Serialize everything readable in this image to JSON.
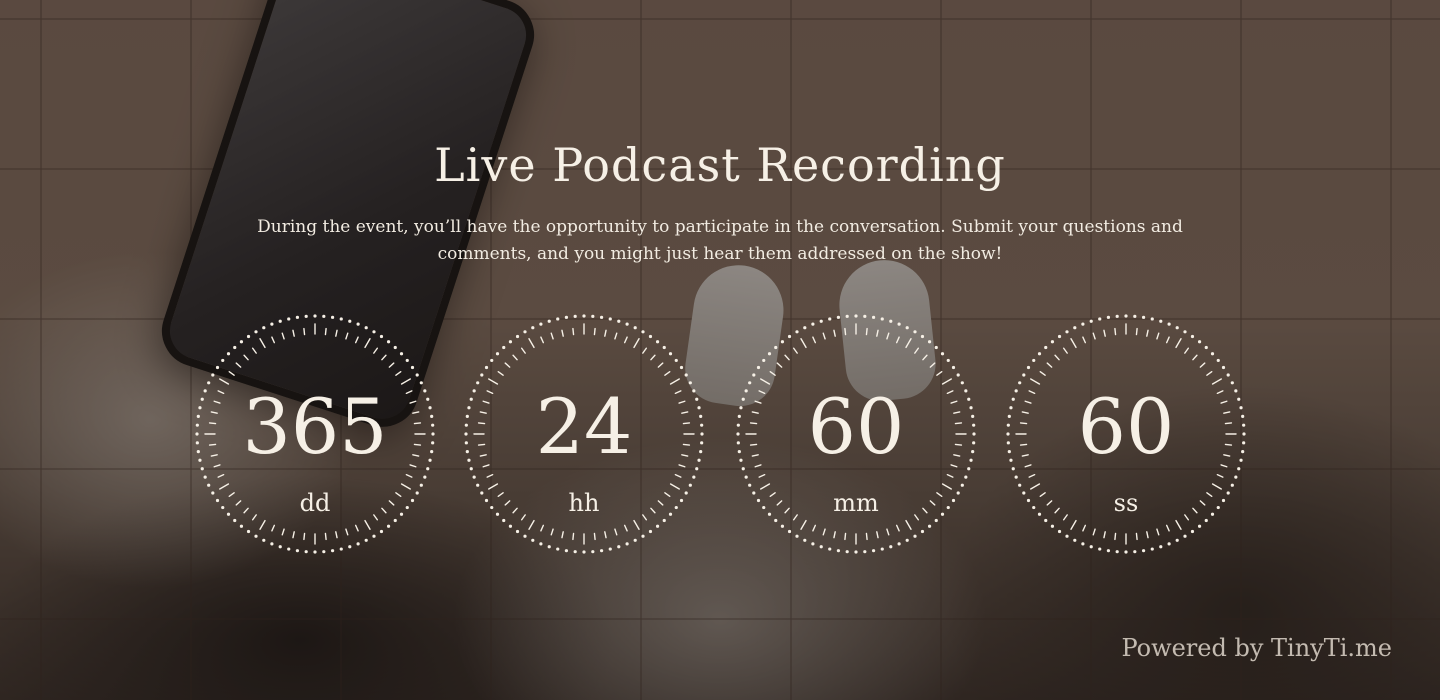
{
  "event": {
    "title": "Live Podcast Recording",
    "description": "During the event, you’ll have the opportunity to participate in the conversation. Submit your questions and comments, and you might just hear them addressed on the show!"
  },
  "countdown": [
    {
      "value": "365",
      "unit": "dd"
    },
    {
      "value": "24",
      "unit": "hh"
    },
    {
      "value": "60",
      "unit": "mm"
    },
    {
      "value": "60",
      "unit": "ss"
    }
  ],
  "footer": {
    "powered_by": "Powered by TinyTi.me"
  },
  "colors": {
    "text": "#f6f0e6",
    "overlay": "#1e1612"
  }
}
